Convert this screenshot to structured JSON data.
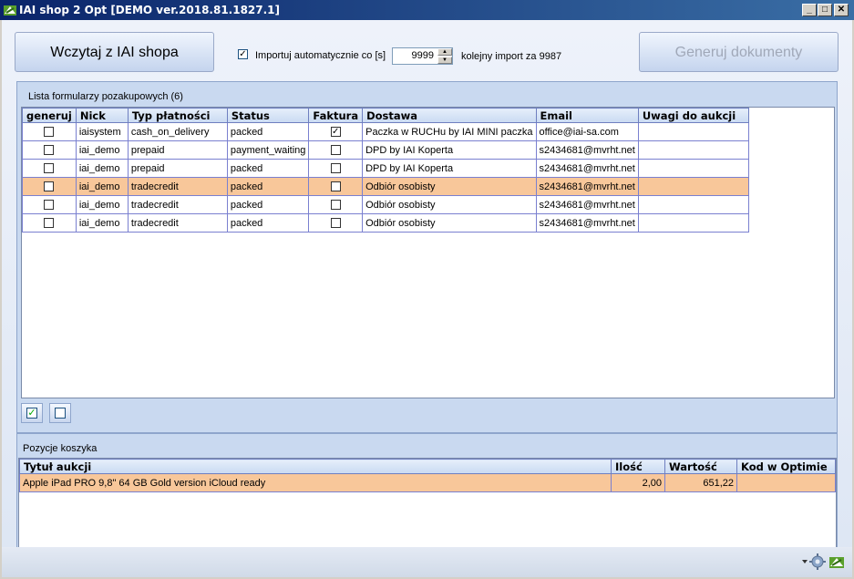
{
  "window": {
    "title": "IAI shop 2 Opt [DEMO ver.2018.81.1827.1]",
    "minimize_glyph": "_",
    "maximize_glyph": "□",
    "close_glyph": "✕"
  },
  "toolbar": {
    "load_button": "Wczytaj z IAI shopa",
    "auto_import_label": "Importuj automatycznie co [s]",
    "auto_import_checked": true,
    "interval_value": "9999",
    "next_import_label": "kolejny import za 9987",
    "generate_button": "Generuj dokumenty"
  },
  "forms_panel": {
    "title": "Lista formularzy pozakupowych (6)",
    "columns": [
      "generuj",
      "Nick",
      "Typ płatności",
      "Status",
      "Faktura",
      "Dostawa",
      "Email",
      "Uwagi do aukcji"
    ],
    "rows": [
      {
        "generuj": false,
        "nick": "iaisystem",
        "payment": "cash_on_delivery",
        "status": "packed",
        "faktura": true,
        "delivery": "Paczka w RUCHu by IAI MINI paczka",
        "email": "office@iai-sa.com",
        "notes": "",
        "selected": false
      },
      {
        "generuj": false,
        "nick": "iai_demo",
        "payment": "prepaid",
        "status": "payment_waiting",
        "faktura": false,
        "delivery": "DPD by IAI Koperta",
        "email": "s2434681@mvrht.net",
        "notes": "",
        "selected": false
      },
      {
        "generuj": false,
        "nick": "iai_demo",
        "payment": "prepaid",
        "status": "packed",
        "faktura": false,
        "delivery": "DPD by IAI Koperta",
        "email": "s2434681@mvrht.net",
        "notes": "",
        "selected": false
      },
      {
        "generuj": false,
        "nick": "iai_demo",
        "payment": "tradecredit",
        "status": "packed",
        "faktura": false,
        "delivery": "Odbiór osobisty",
        "email": "s2434681@mvrht.net",
        "notes": "",
        "selected": true
      },
      {
        "generuj": false,
        "nick": "iai_demo",
        "payment": "tradecredit",
        "status": "packed",
        "faktura": false,
        "delivery": "Odbiór osobisty",
        "email": "s2434681@mvrht.net",
        "notes": "",
        "selected": false
      },
      {
        "generuj": false,
        "nick": "iai_demo",
        "payment": "tradecredit",
        "status": "packed",
        "faktura": false,
        "delivery": "Odbiór osobisty",
        "email": "s2434681@mvrht.net",
        "notes": "",
        "selected": false
      }
    ]
  },
  "basket_panel": {
    "title": "Pozycje koszyka",
    "columns": [
      "Tytuł aukcji",
      "Ilość",
      "Wartość",
      "Kod w Optimie"
    ],
    "rows": [
      {
        "title": "Apple iPad PRO 9,8\" 64 GB Gold version iCloud ready",
        "qty": "2,00",
        "value": "651,22",
        "code": "",
        "selected": true
      }
    ]
  },
  "colors": {
    "selected_row": "#f8c79a",
    "title_bar": "#0a246a",
    "panel_bg": "#c9d9f0"
  },
  "icons": [
    "app-icon",
    "select-all-icon",
    "deselect-all-icon",
    "settings-gear-icon",
    "app-tray-icon",
    "dropdown-arrow-icon"
  ]
}
